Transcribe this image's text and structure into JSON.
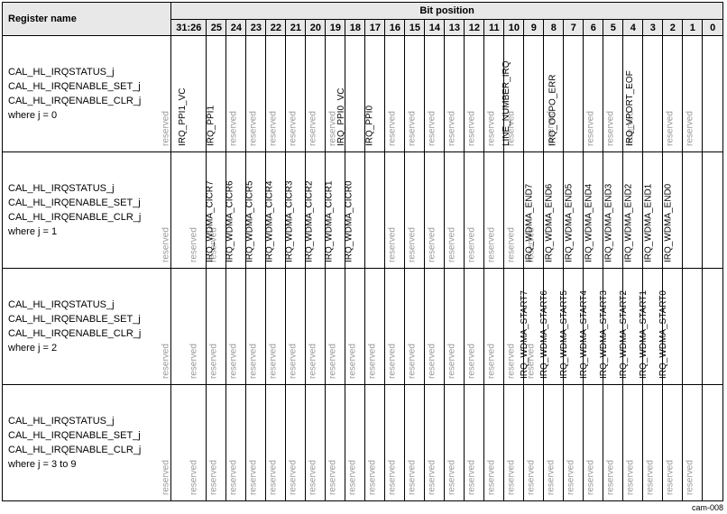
{
  "headers": {
    "register_name": "Register name",
    "bit_position": "Bit position",
    "bits": [
      "31:26",
      "25",
      "24",
      "23",
      "22",
      "21",
      "20",
      "19",
      "18",
      "17",
      "16",
      "15",
      "14",
      "13",
      "12",
      "11",
      "10",
      "9",
      "8",
      "7",
      "6",
      "5",
      "4",
      "3",
      "2",
      "1",
      "0"
    ]
  },
  "rows": [
    {
      "name_lines": [
        "CAL_HL_IRQSTATUS_j",
        "CAL_HL_IRQENABLE_SET_j",
        "CAL_HL_IRQENABLE_CLR_j",
        "where j = 0"
      ],
      "cells": [
        "reserved",
        "IRQ_PPI1_VC",
        "IRQ_PPI1",
        "reserved",
        "reserved",
        "reserved",
        "reserved",
        "reserved",
        "reserved",
        "IRQ_PPI0_VC",
        "IRQ_PPI0",
        "reserved",
        "reserved",
        "reserved",
        "reserved",
        "reserved",
        "reserved",
        "reserved",
        "LINE_NUMBER_IRQ",
        "reserved",
        "IRQ_OCPO_ERR",
        "reserved",
        "reserved",
        "reserved",
        "IRQ_VPORT_EOF",
        "reserved",
        "reserved"
      ]
    },
    {
      "name_lines": [
        "CAL_HL_IRQSTATUS_j",
        "CAL_HL_IRQENABLE_SET_j",
        "CAL_HL_IRQENABLE_CLR_j",
        "where j = 1"
      ],
      "cells": [
        "reserved",
        "reserved",
        "reserved",
        "IRQ_WDMA_CICR7",
        "IRQ_WDMA_CICR6",
        "IRQ_WDMA_CICR5",
        "IRQ_WDMA_CICR4",
        "IRQ_WDMA_CICR3",
        "IRQ_WDMA_CICR2",
        "IRQ_WDMA_CICR1",
        "IRQ_WDMA_CICR0",
        "reserved",
        "reserved",
        "reserved",
        "reserved",
        "reserved",
        "reserved",
        "reserved",
        "reserved",
        "IRQ_WDMA_END7",
        "IRQ_WDMA_END6",
        "IRQ_WDMA_END5",
        "IRQ_WDMA_END4",
        "IRQ_WDMA_END3",
        "IRQ_WDMA_END2",
        "IRQ_WDMA_END1",
        "IRQ_WDMA_END0"
      ]
    },
    {
      "name_lines": [
        "CAL_HL_IRQSTATUS_j",
        "CAL_HL_IRQENABLE_SET_j",
        "CAL_HL_IRQENABLE_CLR_j",
        "where j = 2"
      ],
      "cells": [
        "reserved",
        "reserved",
        "reserved",
        "reserved",
        "reserved",
        "reserved",
        "reserved",
        "reserved",
        "reserved",
        "reserved",
        "reserved",
        "reserved",
        "reserved",
        "reserved",
        "reserved",
        "reserved",
        "reserved",
        "reserved",
        "reserved",
        "IRQ_WDMA_START7",
        "IRQ_WDMA_START6",
        "IRQ_WDMA_START5",
        "IRQ_WDMA_START4",
        "IRQ_WDMA_START3",
        "IRQ_WDMA_START2",
        "IRQ_WDMA_START1",
        "IRQ_WDMA_START0"
      ]
    },
    {
      "name_lines": [
        "CAL_HL_IRQSTATUS_j",
        "CAL_HL_IRQENABLE_SET_j",
        "CAL_HL_IRQENABLE_CLR_j",
        "where j = 3 to 9"
      ],
      "cells": [
        "reserved",
        "reserved",
        "reserved",
        "reserved",
        "reserved",
        "reserved",
        "reserved",
        "reserved",
        "reserved",
        "reserved",
        "reserved",
        "reserved",
        "reserved",
        "reserved",
        "reserved",
        "reserved",
        "reserved",
        "reserved",
        "reserved",
        "reserved",
        "reserved",
        "reserved",
        "reserved",
        "reserved",
        "reserved",
        "reserved",
        "reserved"
      ]
    }
  ],
  "footer": "cam-008"
}
